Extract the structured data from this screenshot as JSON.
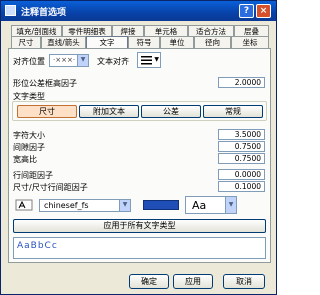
{
  "window": {
    "title": "注释首选项"
  },
  "tabs": {
    "row1": [
      "填充/剖面线",
      "零件明细表",
      "焊接",
      "单元格",
      "适合方法",
      "层叠"
    ],
    "row2": [
      "尺寸",
      "直线/箭头",
      "文字",
      "符号",
      "单位",
      "径向",
      "坐标"
    ],
    "active": "文字"
  },
  "alignment": {
    "position_label": "对齐位置",
    "position_value": "·×××·",
    "justify_label": "文本对齐",
    "justify_icon": "align-lines-icon"
  },
  "tolerance_factor": {
    "label": "形位公差框高因子",
    "value": "2.0000"
  },
  "text_type": {
    "group_label": "文字类型",
    "buttons": [
      "尺寸",
      "附加文本",
      "公差",
      "常规"
    ],
    "selected": "尺寸"
  },
  "params": [
    {
      "label": "字符大小",
      "value": "3.5000"
    },
    {
      "label": "间隙因子",
      "value": "0.7500"
    },
    {
      "label": "宽高比",
      "value": "0.7500"
    },
    {
      "label": "行间距因子",
      "value": "0.0000"
    },
    {
      "label": "尺寸/尺寸行间距因子",
      "value": "0.1000"
    }
  ],
  "font": {
    "value": "chinesef_fs",
    "style_preview": "Aa"
  },
  "apply_all_label": "应用于所有文字类型",
  "preview_text": "AaBbCc",
  "footer": {
    "ok": "确定",
    "apply": "应用",
    "cancel": "取消"
  },
  "colors": {
    "title_bar": "#0842a8",
    "color_swatch": "#1f4fb6",
    "preview_text": "#2a52be"
  }
}
